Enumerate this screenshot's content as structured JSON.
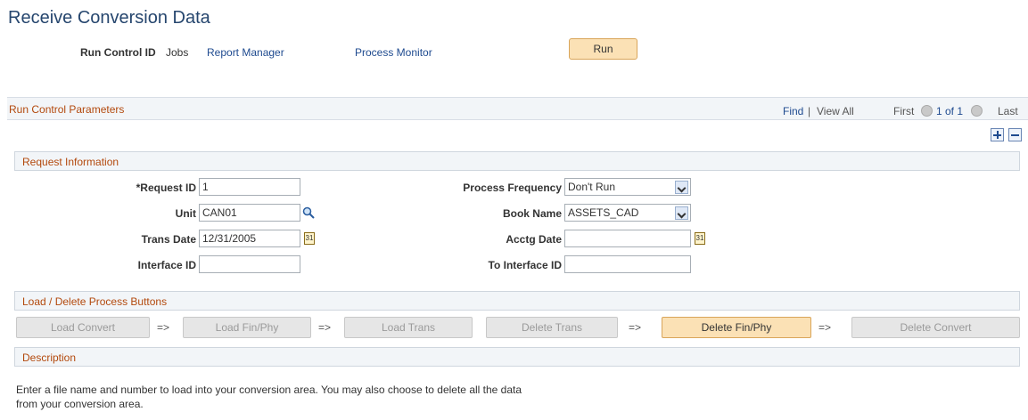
{
  "page": {
    "title": "Receive Conversion Data"
  },
  "header": {
    "run_control_label": "Run Control ID",
    "run_control_value": "Jobs",
    "report_manager": "Report Manager",
    "process_monitor": "Process Monitor",
    "run_label": "Run"
  },
  "run_control_bar": {
    "title": "Run Control Parameters",
    "find": "Find",
    "separator": "|",
    "view_all": "View All",
    "first": "First",
    "page_of": "1 of 1",
    "last": "Last"
  },
  "request_info": {
    "title": "Request Information",
    "request_id_label": "*Request ID",
    "request_id_value": "1",
    "unit_label": "Unit",
    "unit_value": "CAN01",
    "trans_date_label": "Trans Date",
    "trans_date_value": "12/31/2005",
    "interface_id_label": "Interface ID",
    "interface_id_value": "",
    "process_frequency_label": "Process Frequency",
    "process_frequency_value": "Don't Run",
    "book_name_label": "Book Name",
    "book_name_value": "ASSETS_CAD",
    "acctg_date_label": "Acctg Date",
    "acctg_date_value": "",
    "to_interface_id_label": "To Interface ID",
    "to_interface_id_value": ""
  },
  "process_buttons": {
    "title": "Load / Delete Process Buttons",
    "arrow": "=>",
    "load_convert": "Load Convert",
    "load_fin_phy": "Load Fin/Phy",
    "load_trans": "Load Trans",
    "delete_trans": "Delete Trans",
    "delete_fin_phy": "Delete Fin/Phy",
    "delete_convert": "Delete Convert"
  },
  "description": {
    "title": "Description",
    "line1": "Enter a file name and number to load into your conversion area. You may also choose to delete all the data",
    "line2": "from your conversion area."
  },
  "colors": {
    "title": "#26466e",
    "section_title": "#b3490d",
    "link": "#1e4a8f",
    "active_button": "#fbe1b5"
  },
  "icons": {
    "lookup": "magnifier-icon",
    "calendar": "calendar-icon",
    "add_row": "plus-icon",
    "delete_row": "minus-icon",
    "prev": "prev-arrow-icon",
    "next": "next-arrow-icon"
  }
}
